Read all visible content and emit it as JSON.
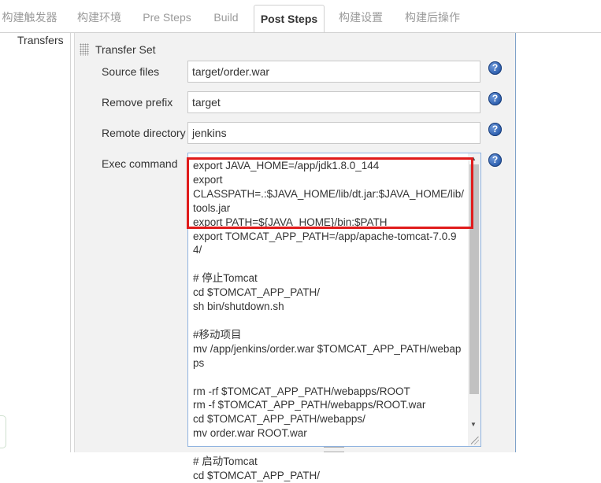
{
  "tabs": [
    {
      "label": "构建触发器",
      "active": false
    },
    {
      "label": "构建环境",
      "active": false
    },
    {
      "label": "Pre Steps",
      "active": false
    },
    {
      "label": "Build",
      "active": false
    },
    {
      "label": "Post Steps",
      "active": true
    },
    {
      "label": "构建设置",
      "active": false
    },
    {
      "label": "构建后操作",
      "active": false
    }
  ],
  "section_label": "Transfers",
  "transfer_set": {
    "title": "Transfer Set",
    "source_files": {
      "label": "Source files",
      "value": "target/order.war"
    },
    "remove_prefix": {
      "label": "Remove prefix",
      "value": "target"
    },
    "remote_directory": {
      "label": "Remote directory",
      "value": "jenkins"
    },
    "exec_command": {
      "label": "Exec command",
      "value": "export JAVA_HOME=/app/jdk1.8.0_144\nexport\nCLASSPATH=.:$JAVA_HOME/lib/dt.jar:$JAVA_HOME/lib/tools.jar\nexport PATH=${JAVA_HOME}/bin:$PATH\nexport TOMCAT_APP_PATH=/app/apache-tomcat-7.0.94/\n\n# 停止Tomcat\ncd $TOMCAT_APP_PATH/\nsh bin/shutdown.sh\n\n#移动项目\nmv /app/jenkins/order.war $TOMCAT_APP_PATH/webapps\n\nrm -rf $TOMCAT_APP_PATH/webapps/ROOT\nrm -f $TOMCAT_APP_PATH/webapps/ROOT.war\ncd $TOMCAT_APP_PATH/webapps/\nmv order.war ROOT.war\n\n# 启动Tomcat\ncd $TOMCAT_APP_PATH/"
    }
  },
  "help_glyph": "?",
  "icons": {
    "help": "help-icon",
    "drag": "drag-handle-icon"
  },
  "colors": {
    "highlight": "#e01b1b",
    "help": "#2a5cac",
    "panel_border": "#7fa2c9"
  }
}
